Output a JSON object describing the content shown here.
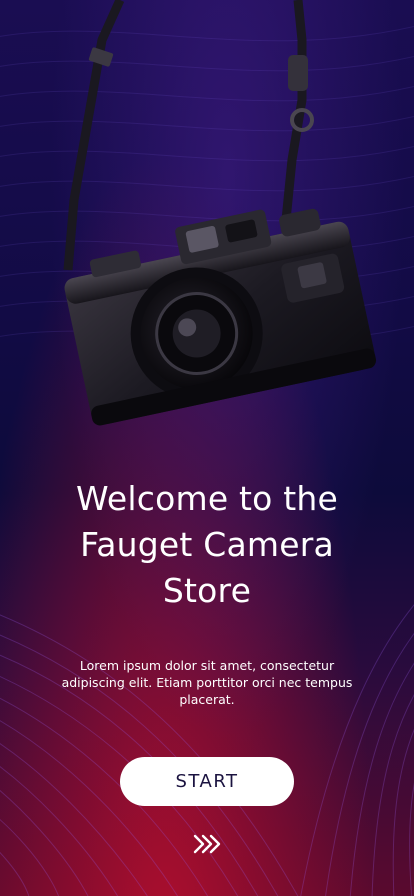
{
  "welcome": {
    "title": "Welcome to the Fauget Camera Store",
    "description": "Lorem ipsum dolor sit amet, consectetur adipiscing elit. Etiam porttitor orci nec tempus placerat.",
    "start_label": "START"
  },
  "icons": {
    "hero": "camera-icon",
    "scroll": "chevrons-right-icon"
  },
  "colors": {
    "accent_blue": "#1a0d52",
    "accent_red": "#be0f2d",
    "button_bg": "#ffffff",
    "button_text": "#1b1340"
  }
}
